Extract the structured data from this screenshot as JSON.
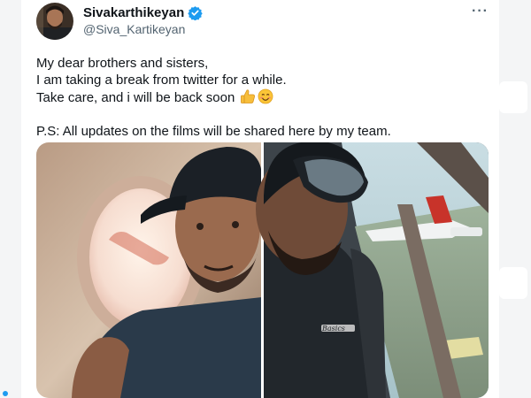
{
  "account": {
    "display_name": "Sivakarthikeyan",
    "handle": "@Siva_Kartikeyan",
    "verified": true
  },
  "menu": {
    "more_label": "···"
  },
  "tweet": {
    "lines": [
      "My dear brothers and sisters,",
      "I am taking a break from twitter for a while.",
      "Take care, and i will be back soon"
    ],
    "emojis": [
      "thumbs-up-icon",
      "smiling-face-icon"
    ],
    "ps": "P.S: All updates on the films will be shared here by my team."
  },
  "media": {
    "images": [
      "selfie-window-seat",
      "selfie-airport-view"
    ],
    "shirt_text": "Basics"
  },
  "colors": {
    "verified_blue": "#1d9bf0",
    "text_primary": "#0f1419",
    "text_secondary": "#536471"
  }
}
